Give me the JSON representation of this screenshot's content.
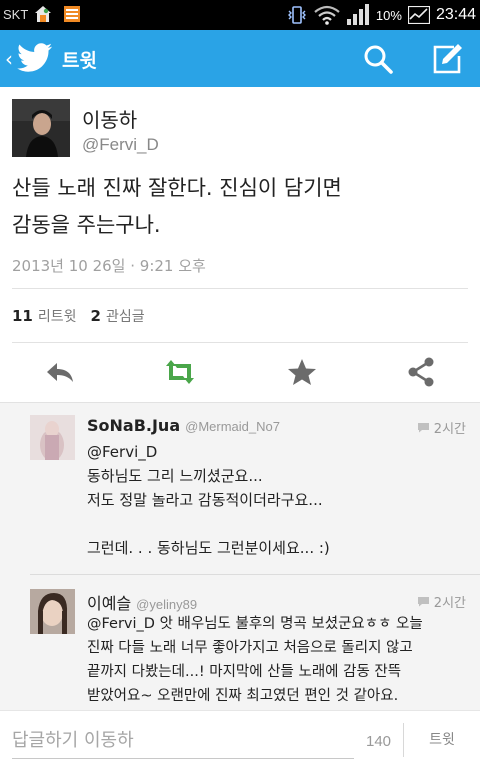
{
  "status_bar": {
    "carrier": "SKT",
    "battery_percent": "10%",
    "time": "23:44"
  },
  "app_bar": {
    "back_icon": "chevron-left-icon",
    "logo_icon": "twitter-bird-icon",
    "title": "트윗",
    "search_icon": "search-icon",
    "compose_icon": "compose-icon",
    "color": "#2aa3e6"
  },
  "tweet": {
    "author_name": "이동하",
    "author_handle": "@Fervi_D",
    "text_line1": "산들 노래 진짜 잘한다. 진심이 담기면",
    "text_line2": "감동을 주는구나.",
    "timestamp": "2013년 10 26일 · 9:21 오후",
    "retweets_count": "11",
    "retweets_label": "리트윗",
    "favorites_count": "2",
    "favorites_label": "관심글",
    "actions": [
      "reply-icon",
      "retweet-icon",
      "favorite-icon",
      "share-icon"
    ],
    "retweet_color": "#5cb85c"
  },
  "replies": [
    {
      "name": "SoNaB.Jua",
      "handle": "@Mermaid_No7",
      "time": "2시간",
      "lines": [
        "@Fervi_D",
        "동하님도 그리 느끼셨군요...",
        "저도 정말 놀라고 감동적이더라구요...",
        "",
        "그런데. . . 동하님도 그런분이세요... :)"
      ]
    },
    {
      "name": "이예슬",
      "handle": "@yeliny89",
      "time": "2시간",
      "lines": [
        "@Fervi_D 앗 배우님도 불후의 명곡 보셨군요ㅎㅎ 오늘",
        "진짜 다들 노래 너무 좋아가지고 처음으로 돌리지 않고",
        "끝까지 다봤는데...! 마지막에 산들 노래에 감동 잔뜩",
        "받았어요~ 오랜만에 진짜 최고였던 편인 것 같아요."
      ]
    }
  ],
  "reply_bar": {
    "placeholder": "답글하기 이동하",
    "char_count": "140",
    "tweet_button": "트윗"
  }
}
